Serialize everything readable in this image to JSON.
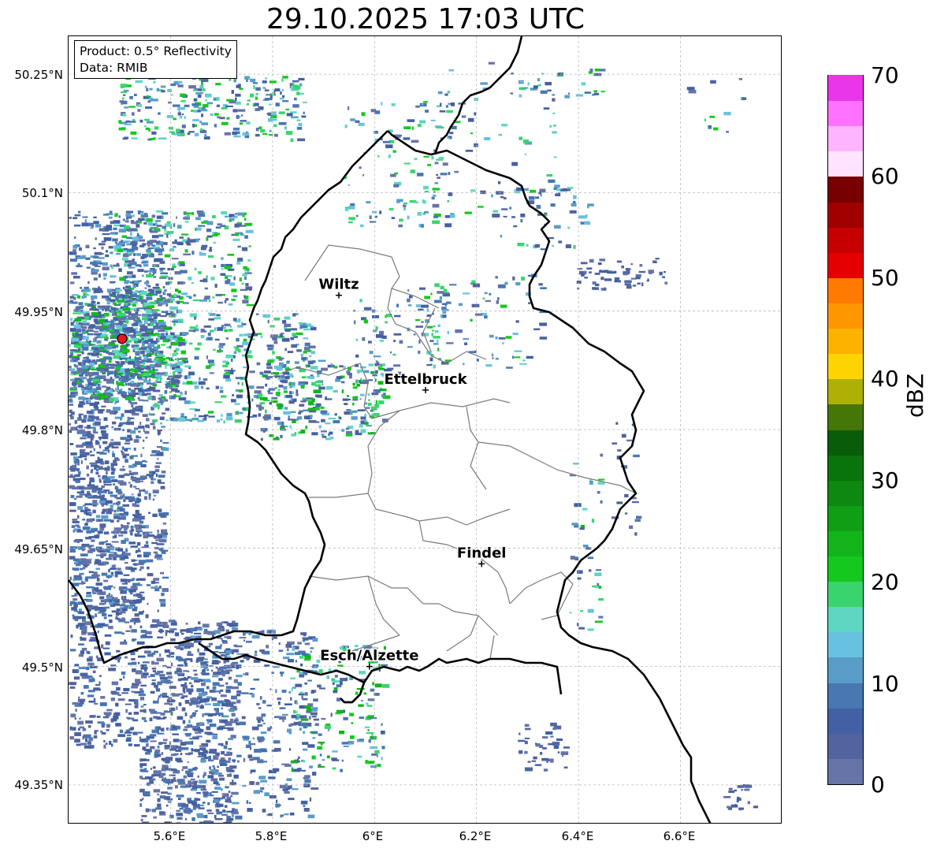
{
  "title": "29.10.2025 17:03 UTC",
  "info_box": {
    "product": "Product: 0.5° Reflectivity",
    "data": "Data: RMIB"
  },
  "lat_ticks": [
    "50.25°N",
    "50.1°N",
    "49.95°N",
    "49.8°N",
    "49.65°N",
    "49.5°N",
    "49.35°N"
  ],
  "lon_ticks": [
    "5.6°E",
    "5.8°E",
    "6°E",
    "6.2°E",
    "6.4°E",
    "6.6°E"
  ],
  "cities": [
    {
      "name": "Wiltz",
      "lon": 5.93,
      "lat": 49.97
    },
    {
      "name": "Ettelbruck",
      "lon": 6.1,
      "lat": 49.85
    },
    {
      "name": "Findel",
      "lon": 6.21,
      "lat": 49.63
    },
    {
      "name": "Esch/Alzette",
      "lon": 5.99,
      "lat": 49.5
    }
  ],
  "radar_site": {
    "lon": 5.505,
    "lat": 49.915,
    "color": "#e8141e"
  },
  "colorbar": {
    "label": "dBZ",
    "ticks": [
      "0",
      "10",
      "20",
      "30",
      "40",
      "50",
      "60",
      "70"
    ],
    "colors": [
      "#6674a8",
      "#51649f",
      "#4260a3",
      "#4877b2",
      "#5a9cc8",
      "#67c1e0",
      "#5ed6c2",
      "#3ad46e",
      "#14c81e",
      "#12b41a",
      "#0f9e14",
      "#0e8810",
      "#0a740c",
      "#095c0a",
      "#457608",
      "#aeb004",
      "#fed400",
      "#fdb200",
      "#fe9600",
      "#fe7a00",
      "#e40000",
      "#c60000",
      "#a20000",
      "#780000",
      "#ffe3ff",
      "#ffb4ff",
      "#ff72ff",
      "#ea36ea"
    ]
  }
}
